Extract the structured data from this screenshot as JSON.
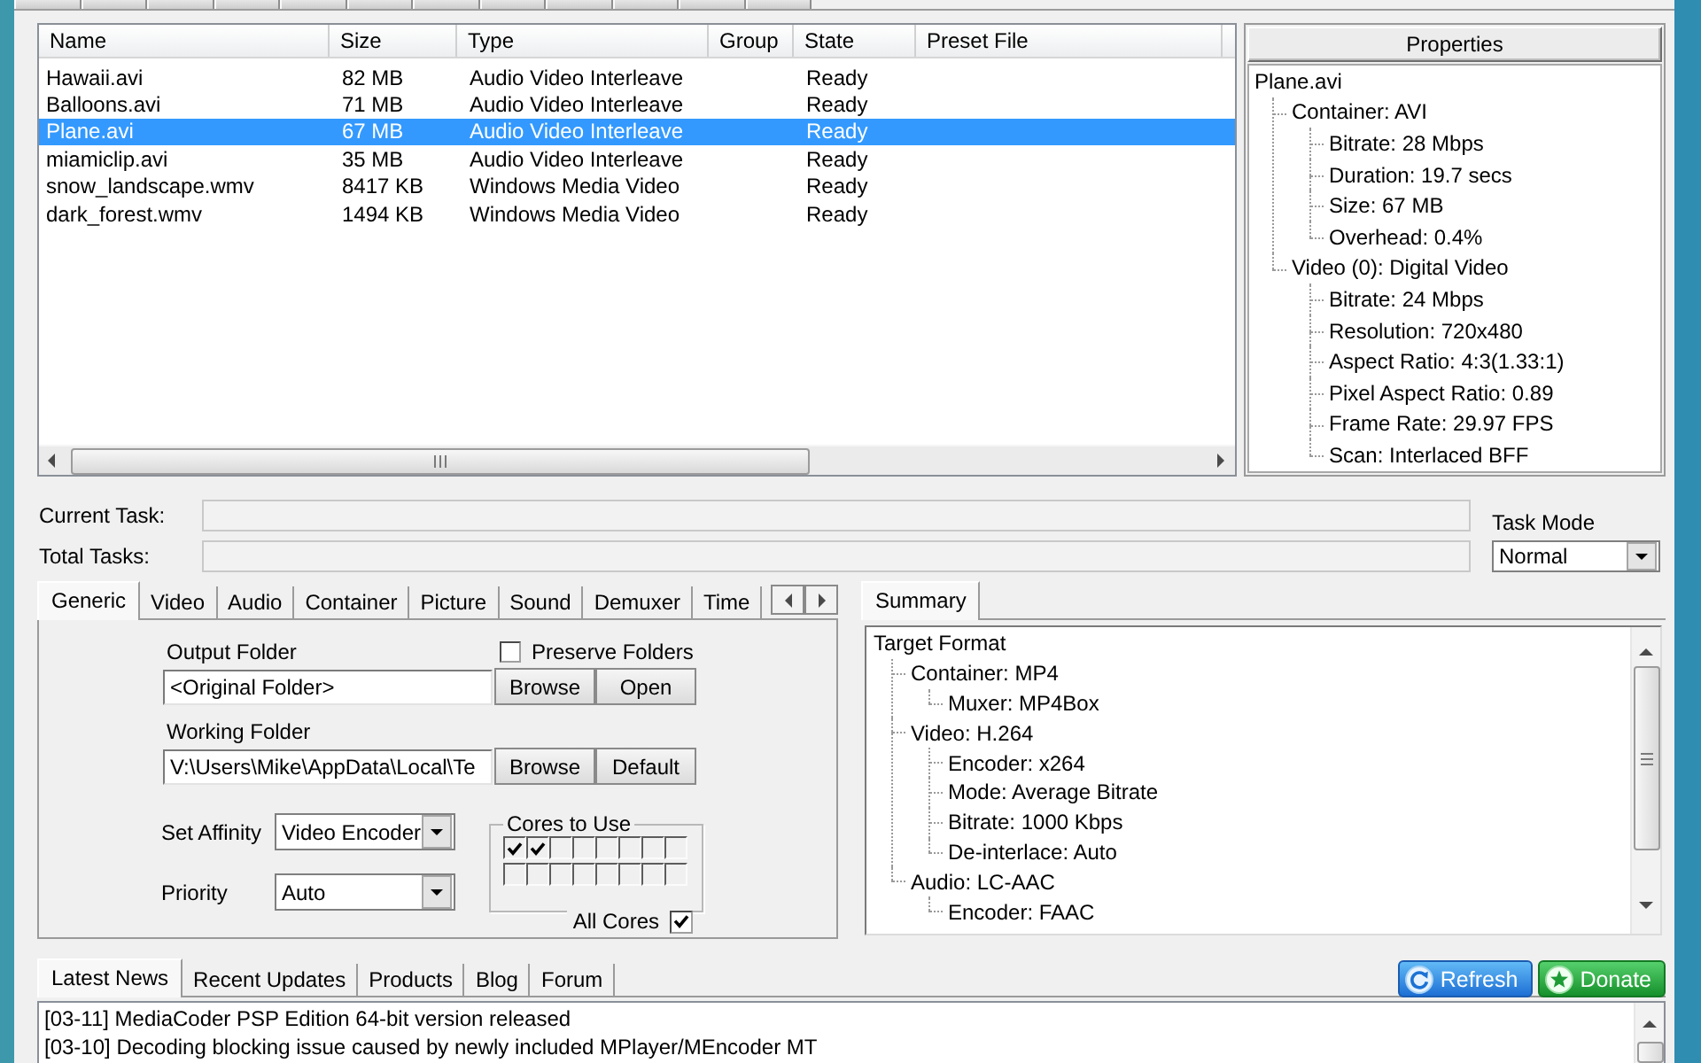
{
  "file_list": {
    "columns": [
      {
        "label": "Name"
      },
      {
        "label": "Size"
      },
      {
        "label": "Type"
      },
      {
        "label": "Group"
      },
      {
        "label": "State"
      },
      {
        "label": "Preset File"
      }
    ],
    "rows": [
      {
        "name": "Hawaii.avi",
        "size": "82 MB",
        "type": "Audio Video Interleave",
        "state": "Ready",
        "selected": false
      },
      {
        "name": "Balloons.avi",
        "size": "71 MB",
        "type": "Audio Video Interleave",
        "state": "Ready",
        "selected": false
      },
      {
        "name": "Plane.avi",
        "size": "67 MB",
        "type": "Audio Video Interleave",
        "state": "Ready",
        "selected": true
      },
      {
        "name": "miamiclip.avi",
        "size": "35 MB",
        "type": "Audio Video Interleave",
        "state": "Ready",
        "selected": false
      },
      {
        "name": "snow_landscape.wmv",
        "size": "8417 KB",
        "type": "Windows Media Video",
        "state": "Ready",
        "selected": false
      },
      {
        "name": "dark_forest.wmv",
        "size": "1494 KB",
        "type": "Windows Media Video",
        "state": "Ready",
        "selected": false
      }
    ]
  },
  "properties": {
    "title": "Properties",
    "tree": {
      "label": "Plane.avi",
      "children": [
        {
          "label": "Container: AVI",
          "children": [
            {
              "label": "Bitrate: 28 Mbps"
            },
            {
              "label": "Duration: 19.7 secs"
            },
            {
              "label": "Size: 67 MB"
            },
            {
              "label": "Overhead: 0.4%"
            }
          ]
        },
        {
          "label": "Video (0): Digital Video",
          "children": [
            {
              "label": "Bitrate: 24 Mbps"
            },
            {
              "label": "Resolution: 720x480"
            },
            {
              "label": "Aspect Ratio: 4:3(1.33:1)"
            },
            {
              "label": "Pixel Aspect Ratio: 0.89"
            },
            {
              "label": "Frame Rate: 29.97 FPS"
            },
            {
              "label": "Scan: Interlaced BFF"
            }
          ]
        }
      ]
    }
  },
  "tasks": [
    {
      "label": "Current Task:"
    },
    {
      "label": "Total Tasks:"
    }
  ],
  "task_mode": {
    "label": "Task Mode",
    "value": "Normal"
  },
  "settings_tabs": [
    {
      "label": "Generic",
      "selected": true
    },
    {
      "label": "Video",
      "selected": false
    },
    {
      "label": "Audio",
      "selected": false
    },
    {
      "label": "Container",
      "selected": false
    },
    {
      "label": "Picture",
      "selected": false
    },
    {
      "label": "Sound",
      "selected": false
    },
    {
      "label": "Demuxer",
      "selected": false
    },
    {
      "label": "Time",
      "selected": false
    }
  ],
  "generic": {
    "output_folder": {
      "label": "Output Folder",
      "value": "<Original Folder>",
      "buttons": [
        "Browse",
        "Open"
      ]
    },
    "preserve_folders": {
      "label": "Preserve Folders",
      "checked": false
    },
    "working_folder": {
      "label": "Working Folder",
      "value": "V:\\Users\\Mike\\AppData\\Local\\Te",
      "buttons": [
        "Browse",
        "Default"
      ]
    },
    "dropdowns": [
      {
        "label": "Set Affinity",
        "value": "Video Encoder"
      },
      {
        "label": "Priority",
        "value": "Auto"
      }
    ],
    "cores": {
      "title": "Cores to Use",
      "rows": [
        {
          "cores": [
            {
              "checked": true
            },
            {
              "checked": true
            },
            {
              "checked": false
            },
            {
              "checked": false
            },
            {
              "checked": false
            },
            {
              "checked": false
            },
            {
              "checked": false
            },
            {
              "checked": false
            }
          ]
        },
        {
          "cores": [
            {
              "checked": false
            },
            {
              "checked": false
            },
            {
              "checked": false
            },
            {
              "checked": false
            },
            {
              "checked": false
            },
            {
              "checked": false
            },
            {
              "checked": false
            },
            {
              "checked": false
            }
          ]
        }
      ],
      "all_cores": {
        "label": "All Cores",
        "checked": true
      }
    }
  },
  "summary": {
    "tabs": [
      {
        "label": "Summary",
        "selected": true
      }
    ],
    "tree": {
      "label": "Target Format",
      "children": [
        {
          "label": "Container: MP4",
          "children": [
            {
              "label": "Muxer: MP4Box"
            }
          ]
        },
        {
          "label": "Video: H.264",
          "children": [
            {
              "label": "Encoder: x264"
            },
            {
              "label": "Mode: Average Bitrate"
            },
            {
              "label": "Bitrate: 1000 Kbps"
            },
            {
              "label": "De-interlace: Auto"
            }
          ]
        },
        {
          "label": "Audio: LC-AAC",
          "children": [
            {
              "label": "Encoder: FAAC"
            }
          ]
        }
      ]
    }
  },
  "news": {
    "tabs": [
      {
        "label": "Latest News",
        "selected": true
      },
      {
        "label": "Recent Updates",
        "selected": false
      },
      {
        "label": "Products",
        "selected": false
      },
      {
        "label": "Blog",
        "selected": false
      },
      {
        "label": "Forum",
        "selected": false
      }
    ],
    "buttons": [
      {
        "label": "Refresh",
        "kind": "refresh"
      },
      {
        "label": "Donate",
        "kind": "donate"
      }
    ],
    "items": [
      "[03-11] MediaCoder PSP Edition 64-bit version released",
      "[03-10] Decoding blocking issue caused by newly included MPlayer/MEncoder MT"
    ]
  }
}
